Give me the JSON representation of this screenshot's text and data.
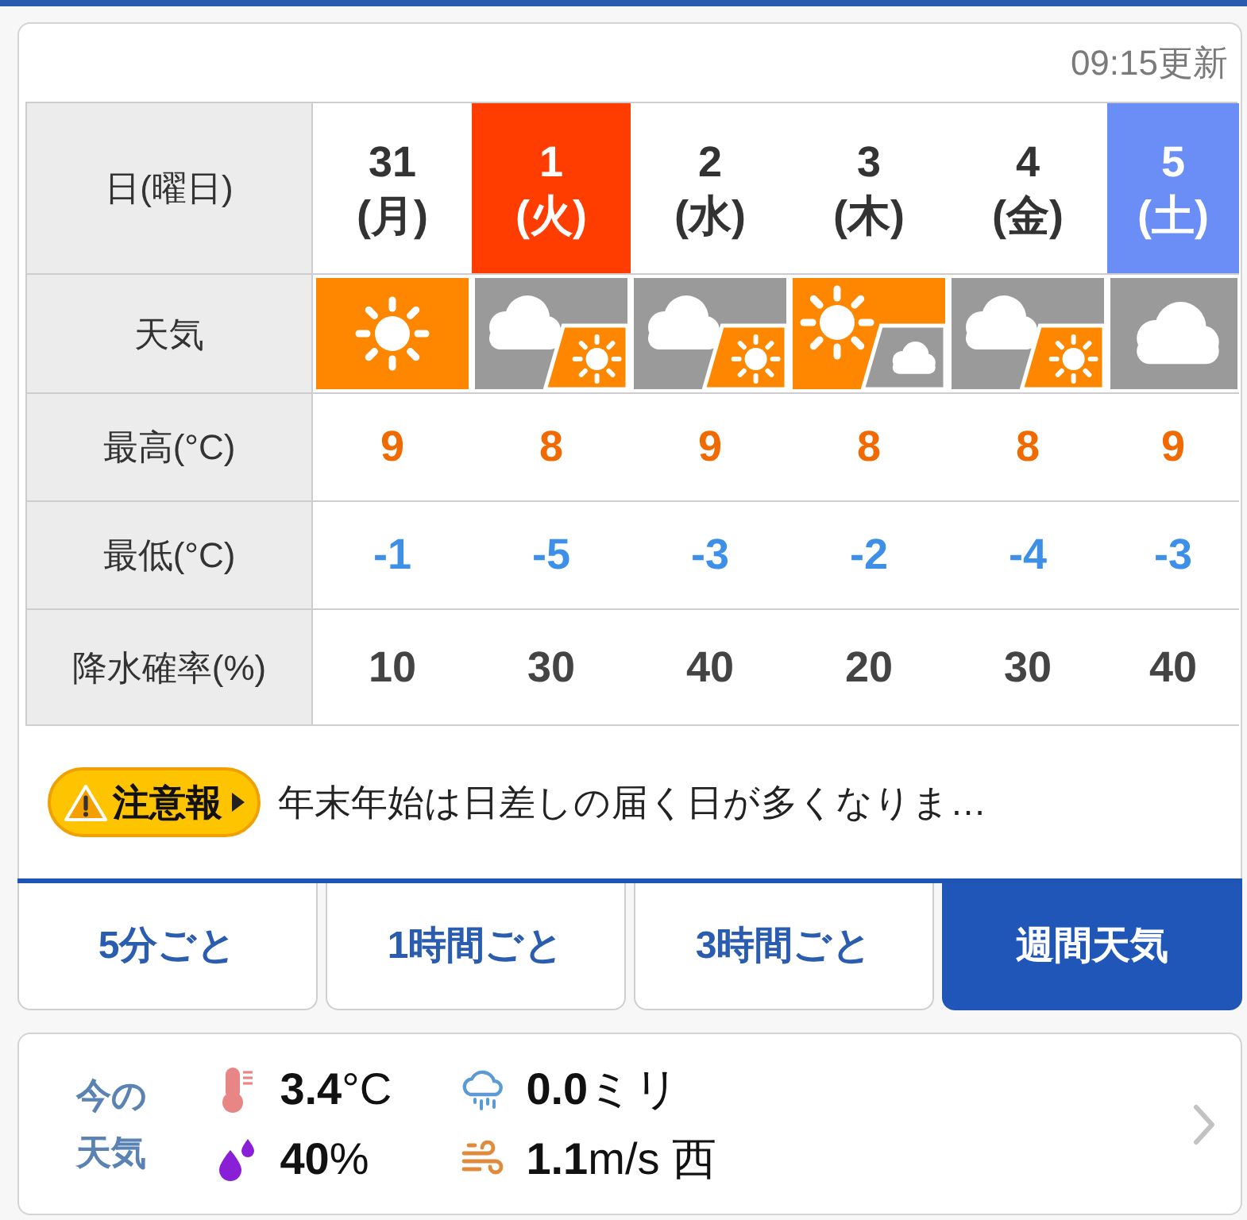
{
  "updated": "09:15更新",
  "table": {
    "row_headers": [
      "日(曜日)",
      "天気",
      "最高(°C)",
      "最低(°C)",
      "降水確率(%)"
    ],
    "days": [
      {
        "date": "31",
        "weekday": "(月)",
        "kind": "weekday",
        "weather": {
          "kind": "sunny"
        },
        "high": "9",
        "low": "-1",
        "precip": "10"
      },
      {
        "date": "1",
        "weekday": "(火)",
        "kind": "holiday",
        "weather": {
          "kind": "cloudy_then_sunny"
        },
        "high": "8",
        "low": "-5",
        "precip": "30"
      },
      {
        "date": "2",
        "weekday": "(水)",
        "kind": "weekday",
        "weather": {
          "kind": "cloudy_then_sunny"
        },
        "high": "9",
        "low": "-3",
        "precip": "40"
      },
      {
        "date": "3",
        "weekday": "(木)",
        "kind": "weekday",
        "weather": {
          "kind": "sunny_then_cloudy"
        },
        "high": "8",
        "low": "-2",
        "precip": "20"
      },
      {
        "date": "4",
        "weekday": "(金)",
        "kind": "weekday",
        "weather": {
          "kind": "cloudy_then_sunny"
        },
        "high": "8",
        "low": "-4",
        "precip": "30"
      },
      {
        "date": "5",
        "weekday": "(土)",
        "kind": "saturday",
        "weather": {
          "kind": "cloudy"
        },
        "high": "9",
        "low": "-3",
        "precip": "40"
      }
    ]
  },
  "notice": {
    "badge": "注意報",
    "text": "年末年始は日差しの届く日が多くなりま…"
  },
  "tabs": [
    {
      "label": "5分ごと",
      "selected": false
    },
    {
      "label": "1時間ごと",
      "selected": false
    },
    {
      "label": "3時間ごと",
      "selected": false
    },
    {
      "label": "週間天気",
      "selected": true
    }
  ],
  "current": {
    "title": "今の天気",
    "items": [
      {
        "kind": "temperature",
        "text": "**3.4**°C"
      },
      {
        "kind": "precipitation",
        "text": "**0.0**ミリ"
      },
      {
        "kind": "humidity",
        "text": "**40**%"
      },
      {
        "kind": "wind",
        "text": "**1.1**m/s 西"
      }
    ]
  }
}
